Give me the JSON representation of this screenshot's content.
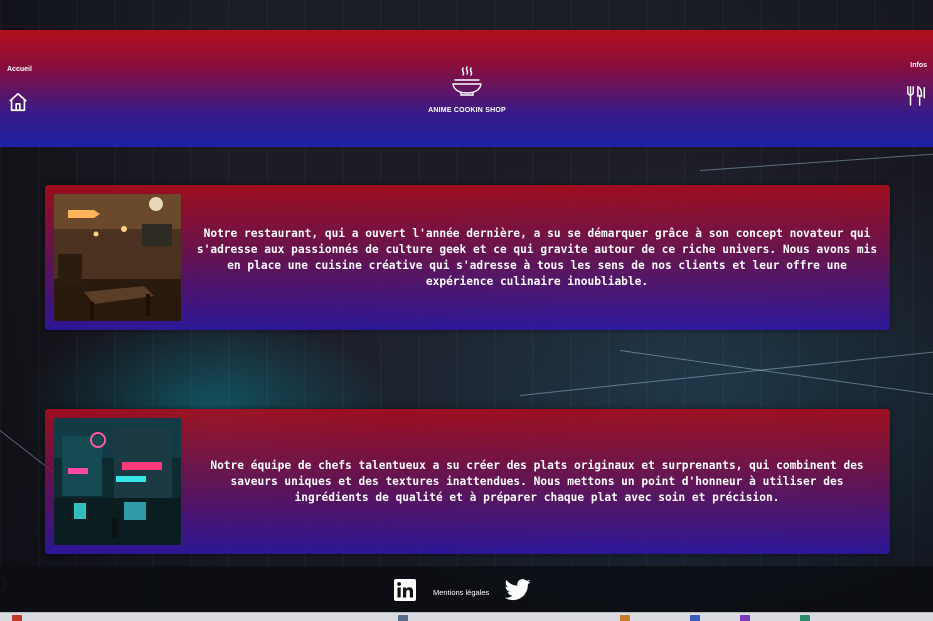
{
  "header": {
    "nav_left_label": "Accueil",
    "nav_left_icon": "home-icon",
    "brand_icon": "ramen-bowl-icon",
    "brand_title": "ANIME COOKIN SHOP",
    "nav_right_label": "Infos",
    "nav_right_icon": "fork-knife-icon",
    "colors": {
      "top": "#b0101c",
      "bottom": "#1d22a6"
    }
  },
  "sections": [
    {
      "image": "restaurant-interior-photo",
      "text": "Notre restaurant, qui a ouvert l'année dernière, a su se démarquer grâce à son concept novateur qui s'adresse aux passionnés de culture geek et ce qui gravite autour de ce riche univers. Nous avons mis en place une cuisine créative qui s'adresse à tous les sens de nos clients et leur offre une expérience culinaire inoubliable."
    },
    {
      "image": "neon-street-photo",
      "text": "Notre équipe de chefs talentueux a su créer des plats originaux et surprenants, qui combinent des saveurs uniques et des textures inattendues. Nous mettons un point d'honneur à utiliser des ingrédients de qualité et à préparer chaque plat avec soin et précision."
    }
  ],
  "footer": {
    "linkedin_icon": "linkedin-icon",
    "mentions_label": "Mentions légales",
    "twitter_icon": "twitter-icon"
  }
}
